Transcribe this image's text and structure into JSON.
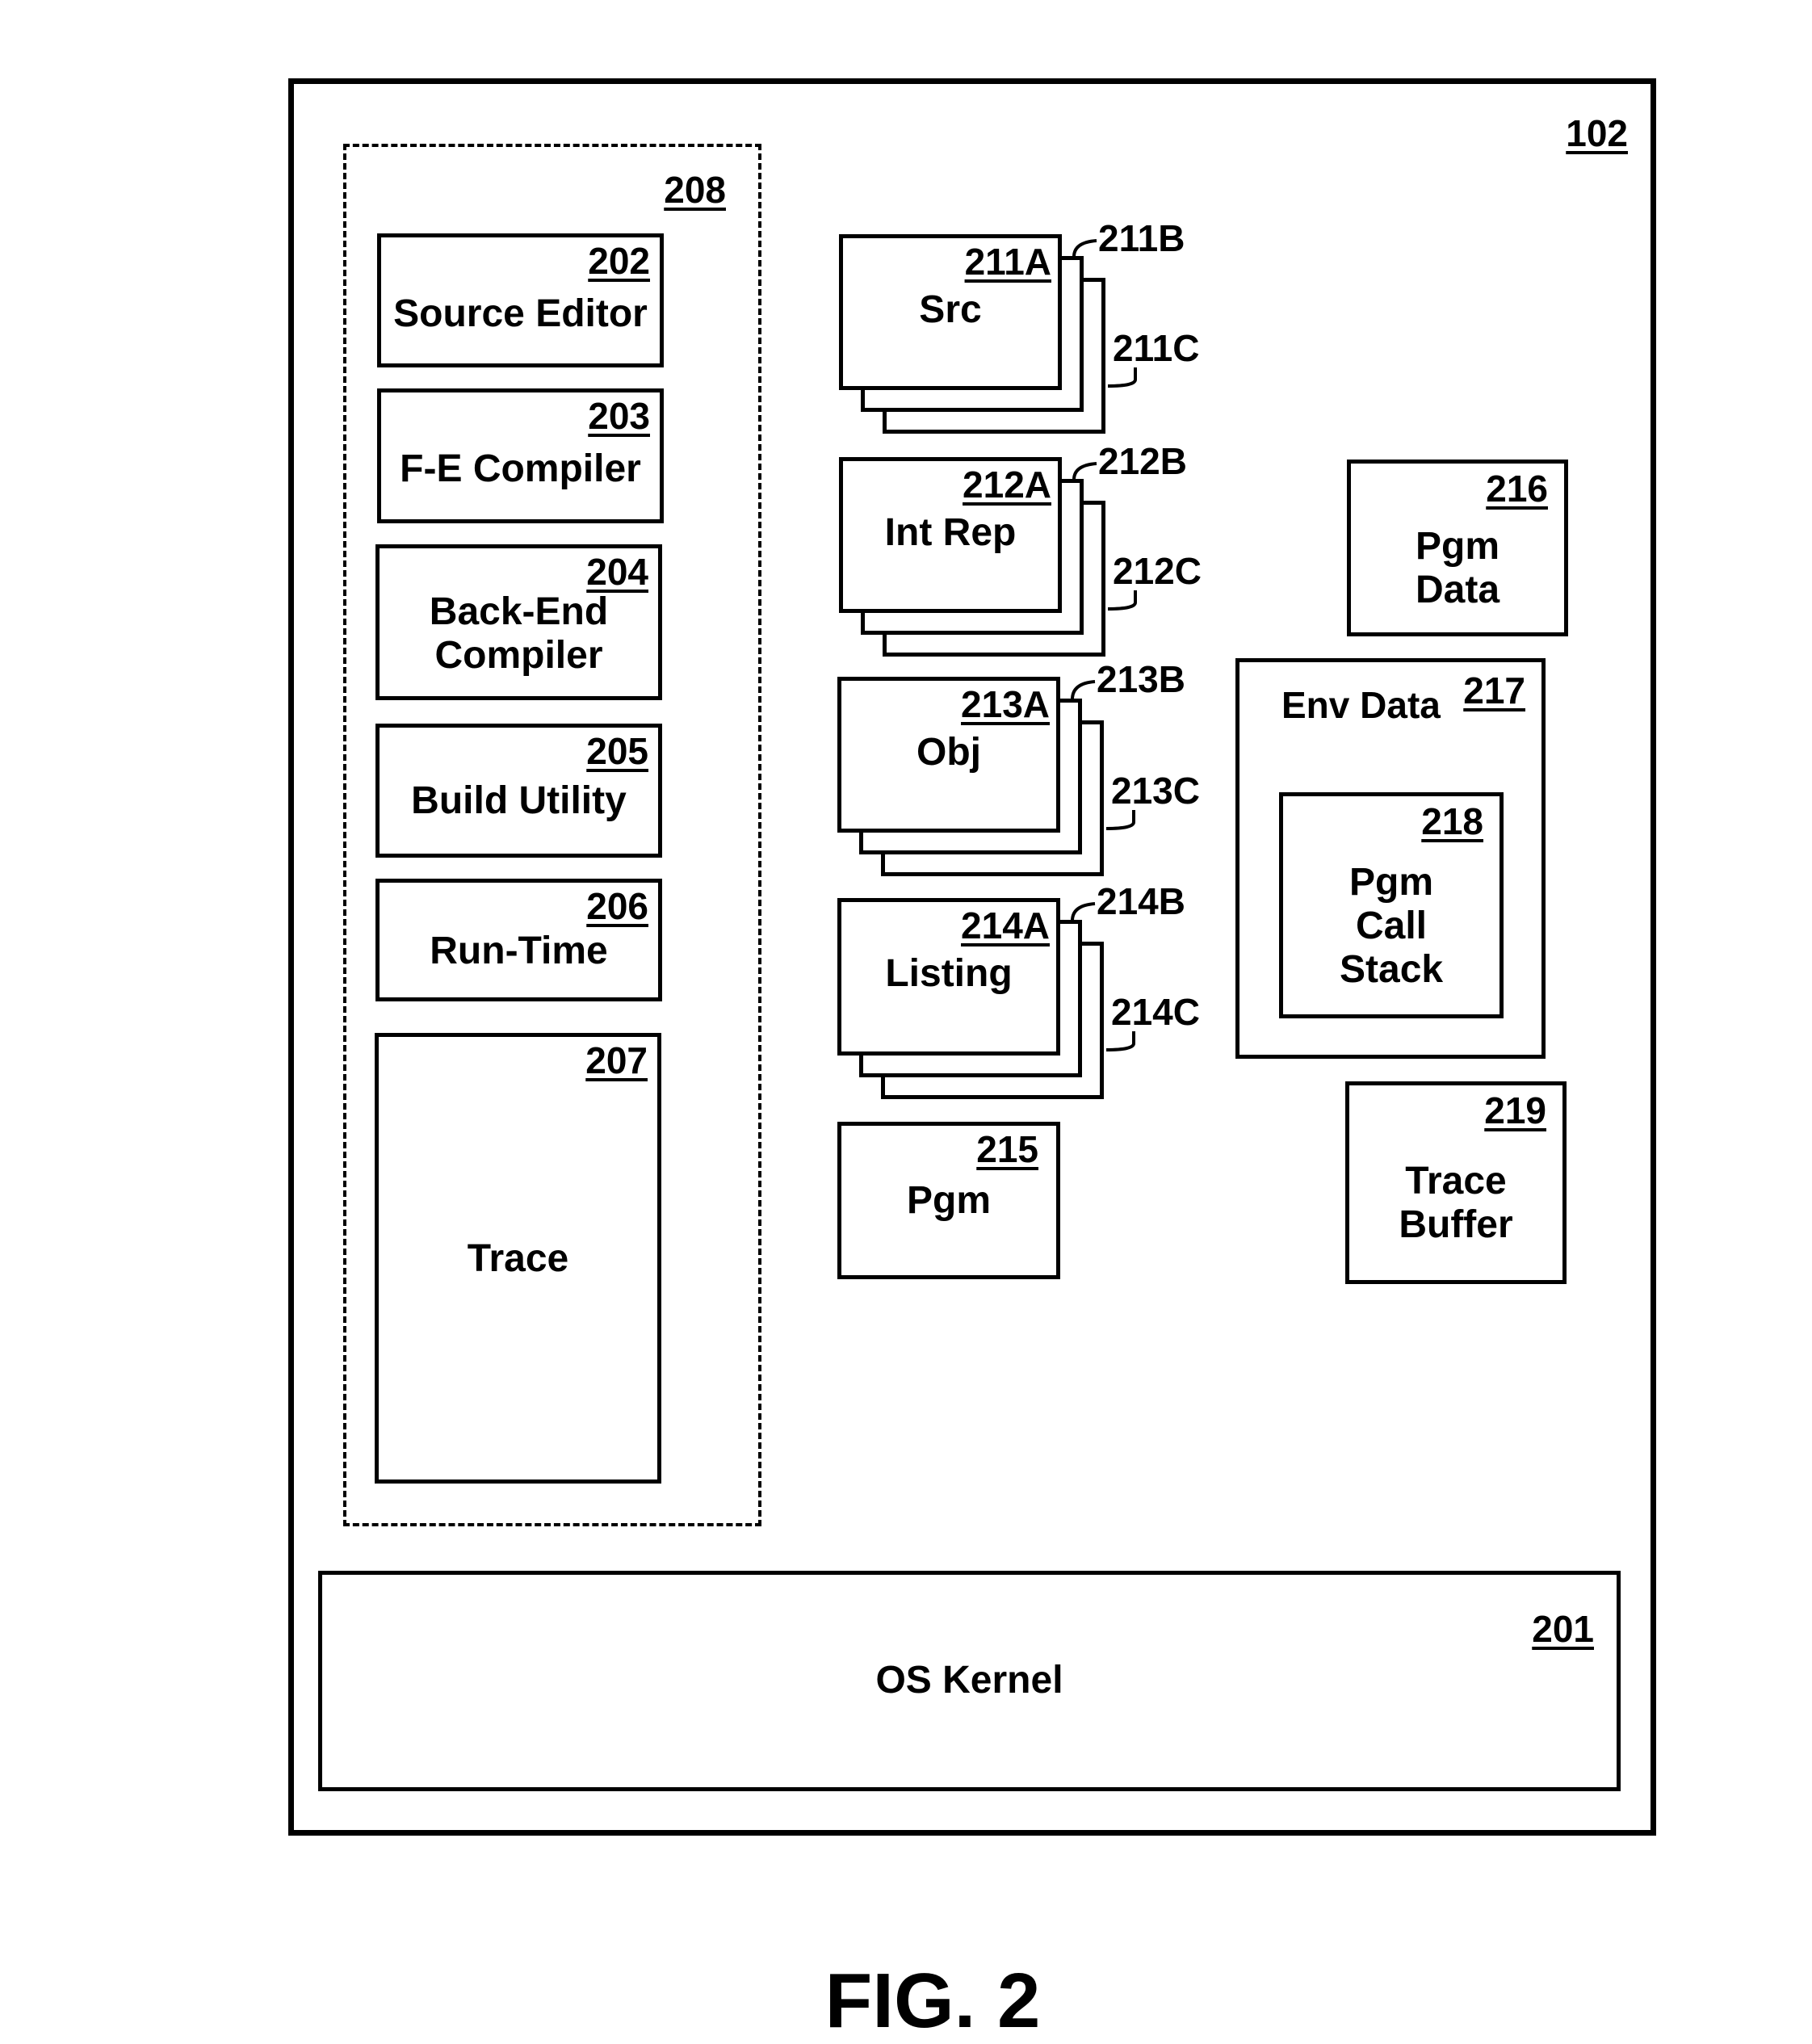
{
  "figure": {
    "caption": "FIG. 2",
    "system": {
      "ref": "102"
    },
    "tool_group": {
      "ref": "208",
      "components": [
        {
          "ref": "202",
          "label": "Source Editor"
        },
        {
          "ref": "203",
          "label": "F-E Compiler"
        },
        {
          "ref": "204",
          "label": "Back-End Compiler"
        },
        {
          "ref": "205",
          "label": "Build Utility"
        },
        {
          "ref": "206",
          "label": "Run-Time"
        },
        {
          "ref": "207",
          "label": "Trace"
        }
      ]
    },
    "stacks": [
      {
        "ref_a": "211A",
        "ref_b": "211B",
        "ref_c": "211C",
        "label": "Src"
      },
      {
        "ref_a": "212A",
        "ref_b": "212B",
        "ref_c": "212C",
        "label": "Int Rep"
      },
      {
        "ref_a": "213A",
        "ref_b": "213B",
        "ref_c": "213C",
        "label": "Obj"
      },
      {
        "ref_a": "214A",
        "ref_b": "214B",
        "ref_c": "214C",
        "label": "Listing"
      }
    ],
    "pgm": {
      "ref": "215",
      "label": "Pgm"
    },
    "pgm_data": {
      "ref": "216",
      "label": "Pgm Data"
    },
    "env_data": {
      "ref": "217",
      "label": "Env Data",
      "call_stack": {
        "ref": "218",
        "label": "Pgm Call Stack"
      }
    },
    "trace_buffer": {
      "ref": "219",
      "label": "Trace Buffer"
    },
    "os_kernel": {
      "ref": "201",
      "label": "OS Kernel"
    }
  }
}
